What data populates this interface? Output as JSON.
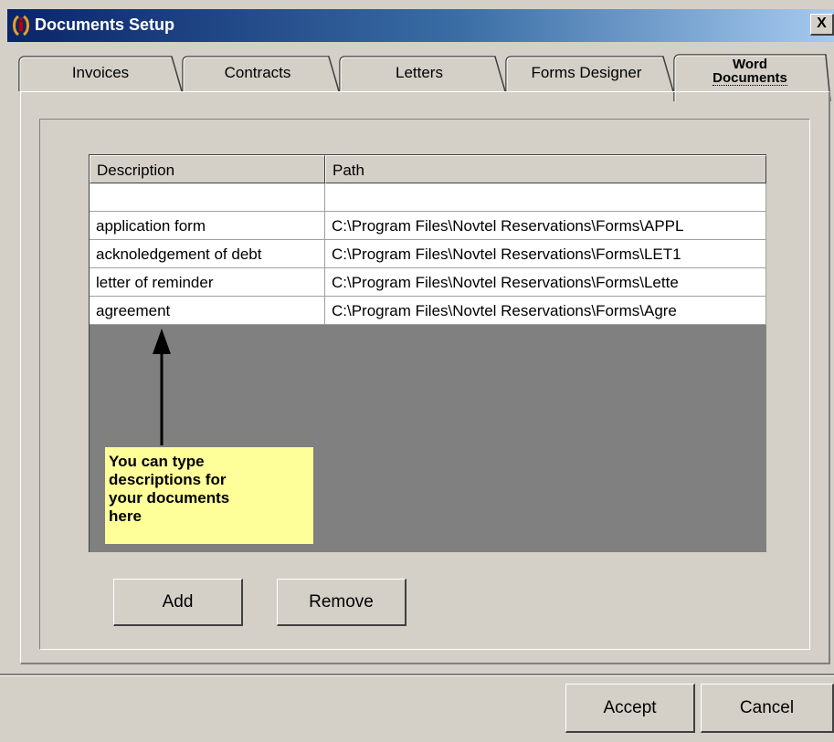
{
  "window": {
    "title": "Documents Setup",
    "close_glyph": "X"
  },
  "tabs": [
    {
      "label": "Invoices"
    },
    {
      "label": "Contracts"
    },
    {
      "label": "Letters"
    },
    {
      "label": "Forms Designer"
    }
  ],
  "active_tab": {
    "line1": "Word",
    "line2": "Documents"
  },
  "table": {
    "headers": {
      "description": "Description",
      "path": "Path"
    },
    "rows": [
      {
        "description": "",
        "path": ""
      },
      {
        "description": "application form",
        "path": "C:\\Program Files\\Novtel Reservations\\Forms\\APPL"
      },
      {
        "description": "acknoledgement of debt",
        "path": "C:\\Program Files\\Novtel Reservations\\Forms\\LET1"
      },
      {
        "description": "letter of reminder",
        "path": "C:\\Program Files\\Novtel Reservations\\Forms\\Lette"
      },
      {
        "description": "agreement",
        "path": "C:\\Program Files\\Novtel Reservations\\Forms\\Agre"
      }
    ]
  },
  "note": {
    "lines": [
      "You can type",
      "descriptions for",
      "your documents",
      "here"
    ]
  },
  "buttons": {
    "add": "Add",
    "remove": "Remove",
    "accept": "Accept",
    "cancel": "Cancel"
  },
  "icons": {
    "app": "app-logo-icon",
    "close": "close-icon",
    "arrow": "arrow-up-icon"
  }
}
